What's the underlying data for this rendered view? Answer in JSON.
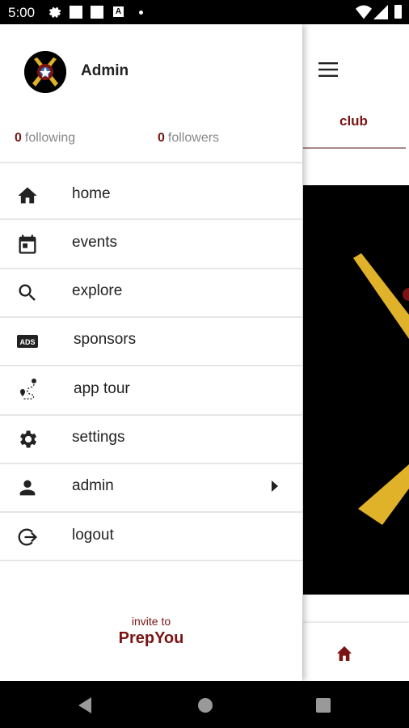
{
  "status_bar": {
    "time": "5:00",
    "icons": [
      "gear-icon",
      "square-icon",
      "square-icon",
      "a-box-icon",
      "dot-icon",
      "wifi-icon",
      "signal-icon",
      "battery-icon"
    ]
  },
  "drawer": {
    "profile": {
      "name": "Admin",
      "following_count": "0",
      "following_label": "following",
      "followers_count": "0",
      "followers_label": "followers"
    },
    "menu": [
      {
        "label": "home",
        "icon": "home-icon"
      },
      {
        "label": "events",
        "icon": "calendar-icon"
      },
      {
        "label": "explore",
        "icon": "search-icon"
      },
      {
        "label": "sponsors",
        "icon": "ads-icon"
      },
      {
        "label": "app tour",
        "icon": "map-route-icon"
      },
      {
        "label": "settings",
        "icon": "gear-icon"
      },
      {
        "label": "admin",
        "icon": "person-icon"
      },
      {
        "label": "logout",
        "icon": "logout-icon"
      }
    ],
    "invite": {
      "small": "invite to",
      "brand": "PrepYou"
    }
  },
  "behind": {
    "tab_label": "club",
    "menu_icon": "hamburger-icon",
    "bottom_icon": "home-icon"
  },
  "colors": {
    "accent": "#7a1414",
    "gold": "#e0b22a"
  }
}
